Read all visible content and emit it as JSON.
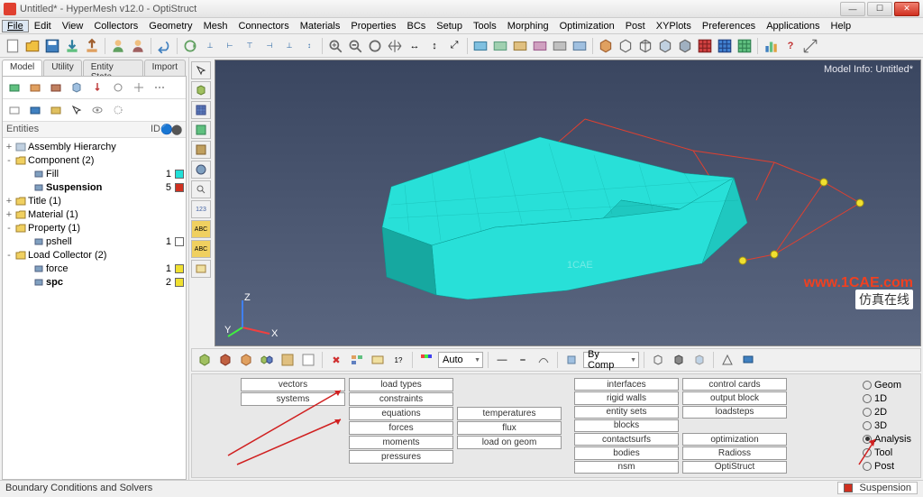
{
  "window": {
    "title": "Untitled* - HyperMesh v12.0 - OptiStruct"
  },
  "menu": [
    "File",
    "Edit",
    "View",
    "Collectors",
    "Geometry",
    "Mesh",
    "Connectors",
    "Materials",
    "Properties",
    "BCs",
    "Setup",
    "Tools",
    "Morphing",
    "Optimization",
    "Post",
    "XYPlots",
    "Preferences",
    "Applications",
    "Help"
  ],
  "leftTabs": [
    "Model",
    "Utility",
    "Entity State",
    "Import"
  ],
  "treeHeader": {
    "c1": "Entities",
    "c2": "ID"
  },
  "tree": [
    {
      "exp": "+",
      "ind": 0,
      "icon": "assy",
      "label": "Assembly Hierarchy"
    },
    {
      "exp": "-",
      "ind": 0,
      "icon": "folder",
      "label": "Component (2)"
    },
    {
      "exp": "",
      "ind": 2,
      "icon": "comp",
      "label": "Fill",
      "id": "1",
      "color": "#20e0d8"
    },
    {
      "exp": "",
      "ind": 2,
      "icon": "comp",
      "label": "Suspension",
      "id": "5",
      "color": "#d03020",
      "bold": true
    },
    {
      "exp": "+",
      "ind": 0,
      "icon": "folder",
      "label": "Title (1)"
    },
    {
      "exp": "+",
      "ind": 0,
      "icon": "folder",
      "label": "Material (1)"
    },
    {
      "exp": "-",
      "ind": 0,
      "icon": "folder",
      "label": "Property (1)"
    },
    {
      "exp": "",
      "ind": 2,
      "icon": "prop",
      "label": "pshell",
      "id": "1",
      "color": "#ffffff"
    },
    {
      "exp": "-",
      "ind": 0,
      "icon": "folder",
      "label": "Load Collector (2)"
    },
    {
      "exp": "",
      "ind": 2,
      "icon": "load",
      "label": "force",
      "id": "1",
      "color": "#f0e030"
    },
    {
      "exp": "",
      "ind": 2,
      "icon": "load",
      "label": "spc",
      "id": "2",
      "color": "#f0e030",
      "bold": true
    }
  ],
  "modelInfo": "Model Info: Untitled*",
  "autoLabel": "Auto",
  "byCompLabel": "By Comp",
  "analysis": {
    "col1": [
      "vectors",
      "systems"
    ],
    "col2": [
      "load types",
      "constraints",
      "equations",
      "forces",
      "moments",
      "pressures"
    ],
    "col3": [
      "",
      "",
      "temperatures",
      "flux",
      "load on geom",
      ""
    ],
    "col4": [
      "interfaces",
      "rigid walls",
      "entity sets",
      "blocks",
      "contactsurfs",
      "bodies",
      "nsm"
    ],
    "col5": [
      "control cards",
      "output block",
      "loadsteps",
      "",
      "optimization",
      "Radioss",
      "OptiStruct"
    ],
    "radios": [
      "Geom",
      "1D",
      "2D",
      "3D",
      "Analysis",
      "Tool",
      "Post"
    ],
    "radioSelected": 4
  },
  "statusLeft": "Boundary Conditions and Solvers",
  "statusRight": "Suspension",
  "watermark": "www.1CAE.com",
  "watermarkCn": "仿真在线"
}
